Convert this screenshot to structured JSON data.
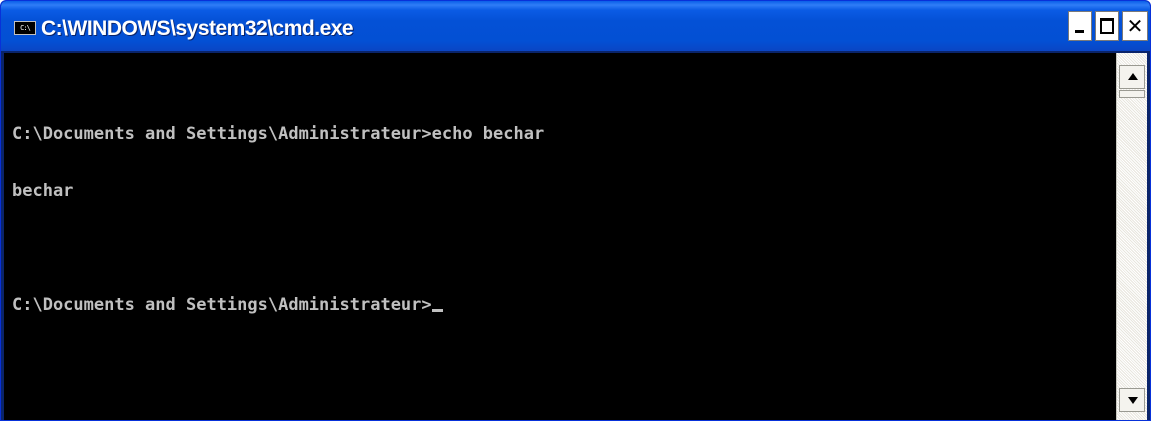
{
  "window": {
    "title": "C:\\WINDOWS\\system32\\cmd.exe",
    "icon": "cmd-icon",
    "icon_text": "C:\\"
  },
  "controls": {
    "minimize": "minimize-icon",
    "maximize": "maximize-icon",
    "close": "close-icon",
    "close_glyph": "✕"
  },
  "console": {
    "lines": [
      "C:\\Documents and Settings\\Administrateur>echo bechar",
      "bechar",
      "",
      "C:\\Documents and Settings\\Administrateur>"
    ],
    "cursor": "_",
    "foreground": "#c0c0c0",
    "background": "#000000"
  },
  "scrollbar": {
    "up": "scroll-up-arrow-icon",
    "down": "scroll-down-arrow-icon"
  },
  "colors": {
    "titlebar": "#0451d6",
    "title_text": "#ffffff"
  }
}
